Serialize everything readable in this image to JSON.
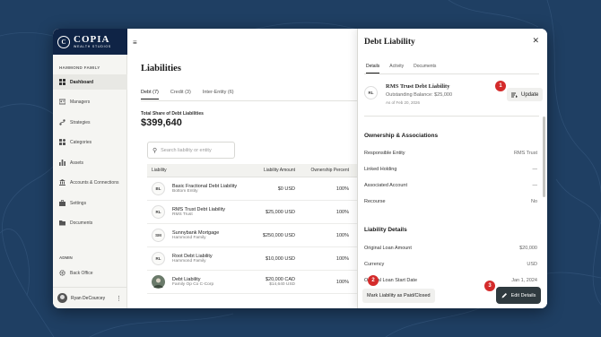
{
  "sidebar": {
    "logo_name": "COPIA",
    "logo_sub": "WEALTH STUDIOS",
    "family_label": "HAMMOND FAMILY",
    "items": [
      {
        "label": "Dashboard",
        "icon": "grid-icon"
      },
      {
        "label": "Managers",
        "icon": "id-card-icon"
      },
      {
        "label": "Strategies",
        "icon": "strategy-icon"
      },
      {
        "label": "Categories",
        "icon": "categories-icon"
      },
      {
        "label": "Assets",
        "icon": "bar-chart-icon"
      },
      {
        "label": "Accounts & Connections",
        "icon": "bank-icon"
      },
      {
        "label": "Settings",
        "icon": "briefcase-icon"
      },
      {
        "label": "Documents",
        "icon": "folder-icon"
      }
    ],
    "admin_label": "ADMIN",
    "back_office_label": "Back Office",
    "user_name": "Ryan DeCourcey"
  },
  "main": {
    "title": "Liabilities",
    "tabs": [
      "Debt (7)",
      "Credit (3)",
      "Inter-Entity (6)"
    ],
    "share_label": "Total Share of Debt Liabilities",
    "share_value": "$399,640",
    "search_placeholder": "Search liability or entity",
    "columns": [
      "Liability",
      "Liability Amount",
      "Ownership Percent"
    ],
    "rows": [
      {
        "initials": "BL",
        "name": "Basic Fractional Debt Liability",
        "entity": "Bottom Entity",
        "amount": "$0 USD",
        "amount2": "",
        "pct": "100%"
      },
      {
        "initials": "RL",
        "name": "RMS Trust Debt Liability",
        "entity": "RMS Trust",
        "amount": "$25,000 USD",
        "amount2": "",
        "pct": "100%"
      },
      {
        "initials": "SM",
        "name": "Sunnybank Mortgage",
        "entity": "Hammond Family",
        "amount": "$250,000 USD",
        "amount2": "",
        "pct": "100%"
      },
      {
        "initials": "RL",
        "name": "Root Debt Liability",
        "entity": "Hammond Family",
        "amount": "$10,000 USD",
        "amount2": "",
        "pct": "100%"
      },
      {
        "initials": "",
        "name": "Debt Liability",
        "entity": "Family Op Co C-Corp",
        "amount": "$20,000 CAD",
        "amount2": "$14,640 USD",
        "pct": "100%"
      }
    ]
  },
  "panel": {
    "title": "Debt Liability",
    "tabs": [
      "Details",
      "Activity",
      "Documents"
    ],
    "initials": "RL",
    "name": "RMS Trust Debt Liability",
    "balance": "Outstanding Balance: $25,000",
    "as_of": "As of Feb 20, 2026",
    "update_label": "Update",
    "section1": "Ownership & Associations",
    "kv1": [
      {
        "k": "Responsible Entity",
        "v": "RMS Trust"
      },
      {
        "k": "Linked Holding",
        "v": "—"
      },
      {
        "k": "Associated Account",
        "v": "—"
      },
      {
        "k": "Recourse",
        "v": "No"
      }
    ],
    "section2": "Liability Details",
    "kv2": [
      {
        "k": "Original Loan Amount",
        "v": "$20,000"
      },
      {
        "k": "Currency",
        "v": "USD"
      },
      {
        "k": "Original Loan Start Date",
        "v": "Jan 1, 2024"
      }
    ],
    "mark_paid_label": "Mark Liability as Paid/Closed",
    "edit_label": "Edit Details"
  },
  "steps": [
    "1",
    "2",
    "3"
  ],
  "colors": {
    "accent": "#0f2446",
    "step": "#d42b2b",
    "edit_button": "#2f3a3f"
  }
}
